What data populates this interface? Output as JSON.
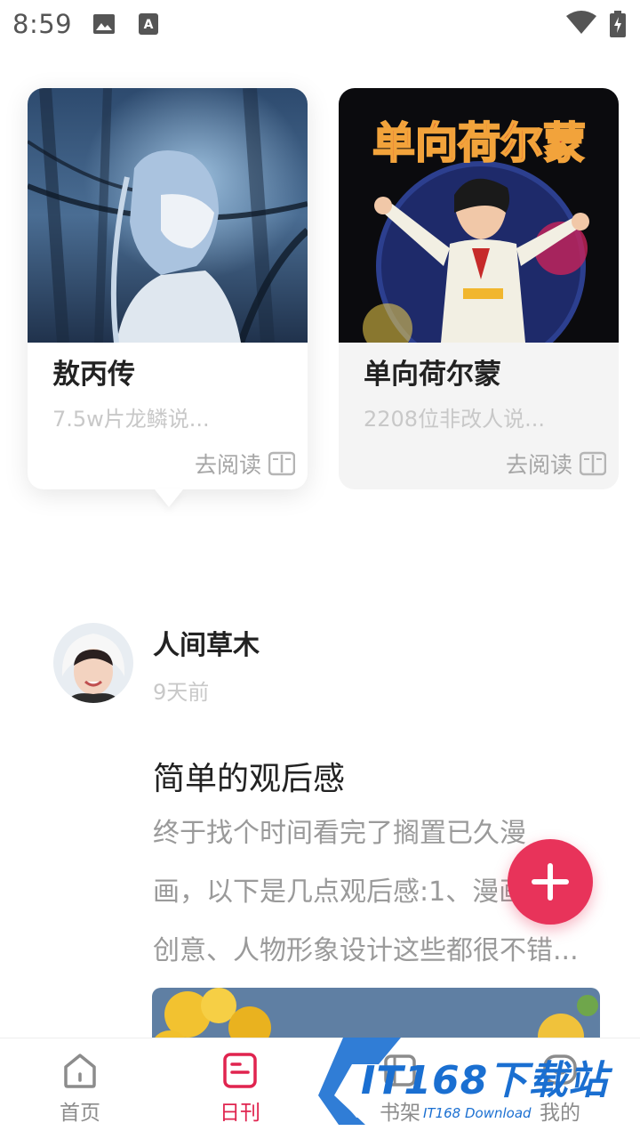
{
  "status_bar": {
    "time": "8:59",
    "icons": [
      "image-icon",
      "a-icon",
      "wifi-icon",
      "battery-charging-icon"
    ]
  },
  "cards": [
    {
      "title": "敖丙传",
      "desc": "7.5w片龙鳞说...",
      "read_label": "去阅读",
      "cover": "blue-dragon-boy-illustration"
    },
    {
      "title": "单向荷尔蒙",
      "desc": "2208位非改人说...",
      "read_label": "去阅读",
      "cover_title": "单向荷尔蒙",
      "cover": "dancing-man-white-suit-illustration"
    }
  ],
  "post": {
    "username": "人间草木",
    "time": "9天前",
    "title": "简单的观后感",
    "body_lines": [
      "终于找个时间看完了搁置已久漫",
      "画，以下是几点观后感:1、漫画内",
      "创意、人物形象设计这些都很不错..."
    ]
  },
  "nav": [
    {
      "label": "首页",
      "icon": "home-icon",
      "active": false
    },
    {
      "label": "日刊",
      "icon": "daily-icon",
      "active": true
    },
    {
      "label": "书架",
      "icon": "bookshelf-icon",
      "active": false
    },
    {
      "label": "我的",
      "icon": "profile-icon",
      "active": false
    }
  ],
  "watermark": {
    "main": "IT168下载站",
    "sub": "IT168 Download"
  },
  "colors": {
    "accent": "#e0244f",
    "fab": "#e8335a",
    "muted_text": "#c8c8c8"
  }
}
